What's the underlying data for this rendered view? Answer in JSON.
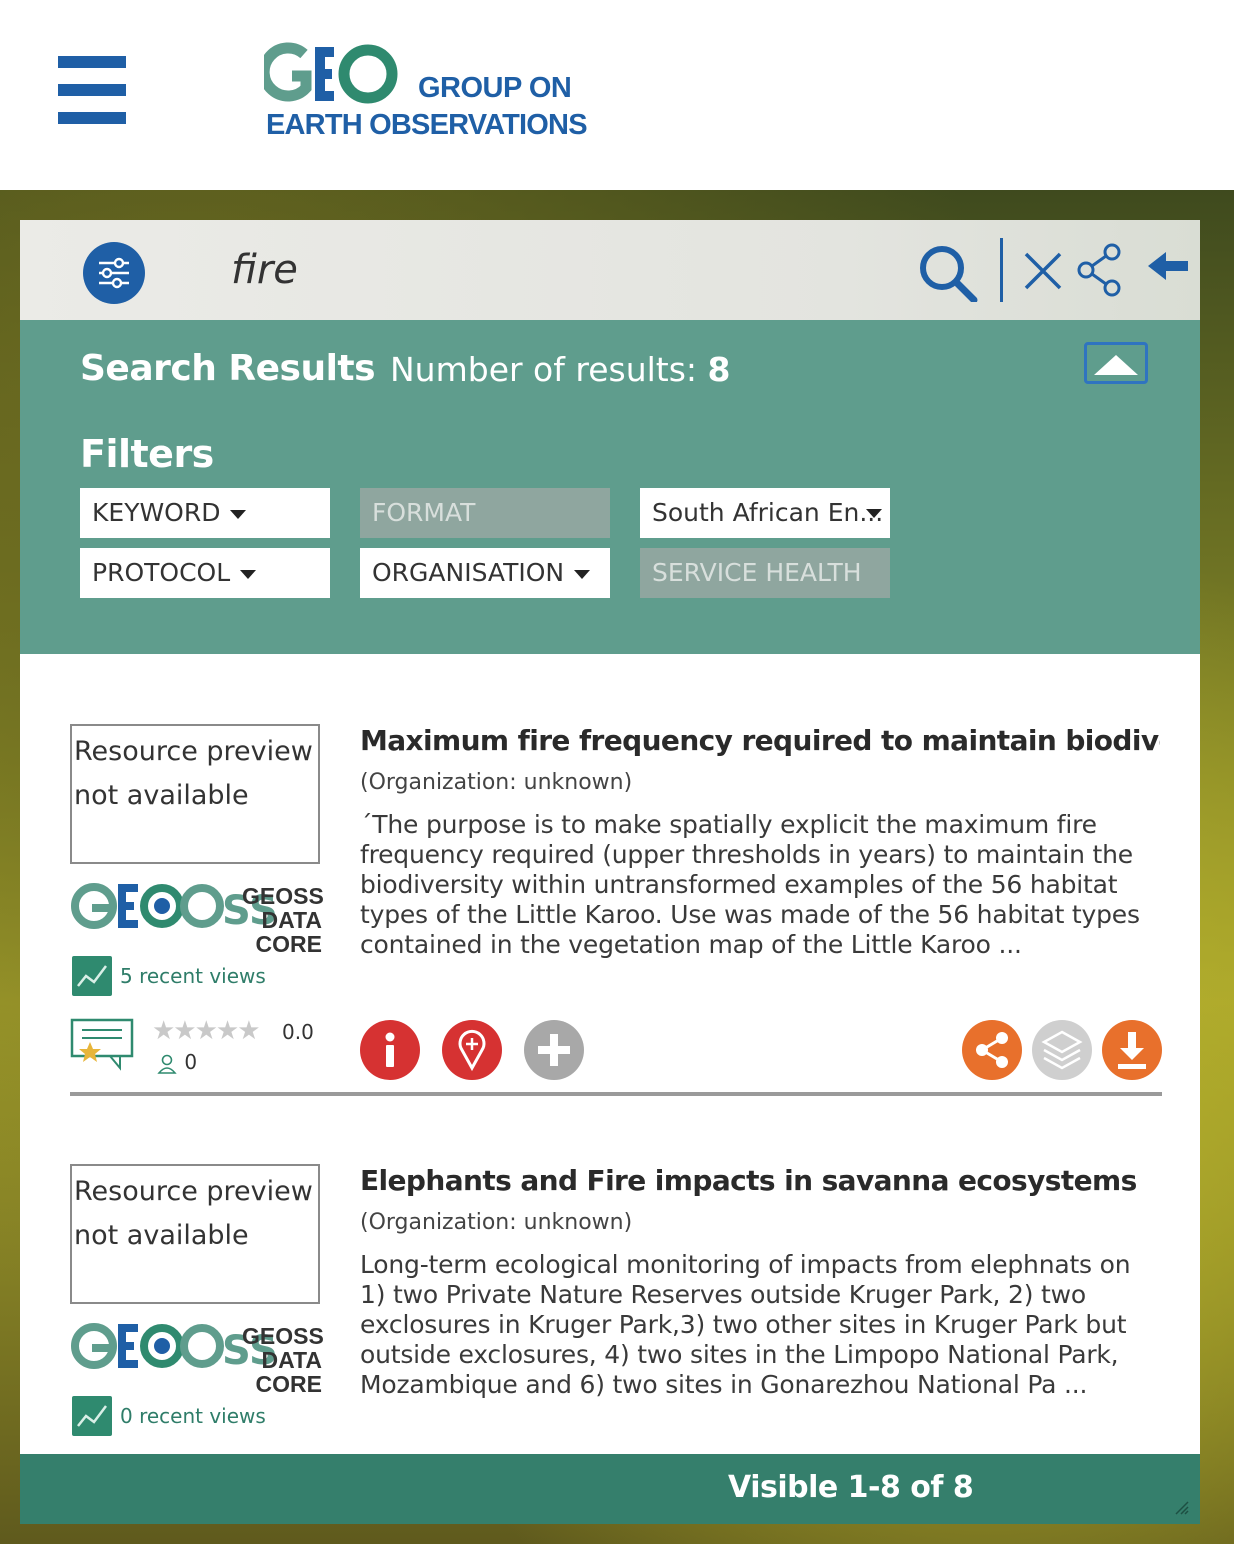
{
  "header": {
    "logo_line1": "GROUP ON",
    "logo_line2": "EARTH OBSERVATIONS",
    "brand_color": "#1f5fa6"
  },
  "search": {
    "query": "fire",
    "icons": [
      "sliders-icon",
      "search-icon",
      "close-icon",
      "share-icon",
      "arrow-left-icon"
    ]
  },
  "results_header": {
    "title": "Search Results",
    "count_label": "Number of results: ",
    "count_value": "8",
    "filters_title": "Filters",
    "bg_color": "#5f9d8d"
  },
  "filters": {
    "keyword": "KEYWORD",
    "format": "FORMAT",
    "source": "South African En...",
    "protocol": "PROTOCOL",
    "organisation": "ORGANISATION",
    "service_health": "SERVICE HEALTH"
  },
  "results": [
    {
      "thumb_alt": "Resource preview not available",
      "source_logo": "GEOSS DATA CORE",
      "views": "5 recent views",
      "rating_value": "0.0",
      "rating_users": "0",
      "title": "Maximum fire frequency required to maintain biodiversity",
      "org": "(Organization: unknown)",
      "description": "´The purpose is to make spatially explicit the maximum fire frequency required (upper thresholds in years) to maintain the biodiversity within untransformed examples of the 56 habitat types of the Little Karoo. Use was made of the 56 habitat types contained in the vegetation map of the Little Karoo ..."
    },
    {
      "thumb_alt": "Resource preview not available",
      "source_logo": "GEOSS DATA CORE",
      "views": "0 recent views",
      "title": "Elephants and Fire impacts in savanna ecosystems",
      "org": "(Organization: unknown)",
      "description": "Long-term ecological monitoring of impacts from elephnats on 1) two Private Nature Reserves outside Kruger Park, 2) two exclosures in Kruger Park,3) two other sites in Kruger Park but outside exclosures, 4) two sites in the Limpopo National Park, Mozambique and 6) two sites in Gonarezhou National Pa ..."
    }
  ],
  "footer": {
    "visible": "Visible 1-8 of 8"
  }
}
